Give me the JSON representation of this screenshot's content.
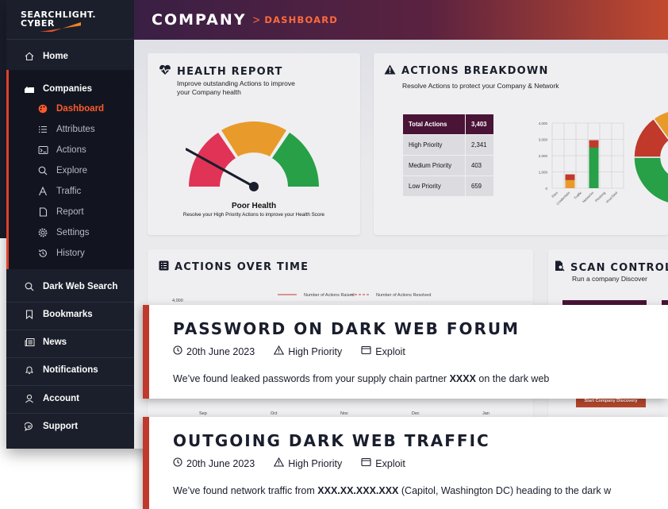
{
  "brand": {
    "line1": "SEARCHLIGHT.",
    "line2": "CYBER"
  },
  "header": {
    "title": "COMPANY",
    "separator": ">",
    "breadcrumb": "DASHBOARD"
  },
  "sidebar": {
    "home": "Home",
    "companies": "Companies",
    "sub_items": [
      {
        "label": "Dashboard",
        "icon": "palette-icon",
        "active": true
      },
      {
        "label": "Attributes",
        "icon": "list-icon"
      },
      {
        "label": "Actions",
        "icon": "actions-icon"
      },
      {
        "label": "Explore",
        "icon": "search-icon"
      },
      {
        "label": "Traffic",
        "icon": "traffic-icon"
      },
      {
        "label": "Report",
        "icon": "report-icon"
      },
      {
        "label": "Settings",
        "icon": "gear-icon"
      },
      {
        "label": "History",
        "icon": "history-icon"
      }
    ],
    "bottom_items": [
      {
        "label": "Dark Web Search",
        "icon": "search-icon"
      },
      {
        "label": "Bookmarks",
        "icon": "bookmark-icon"
      },
      {
        "label": "News",
        "icon": "news-icon"
      },
      {
        "label": "Notifications",
        "icon": "bell-icon"
      },
      {
        "label": "Account",
        "icon": "user-icon"
      },
      {
        "label": "Support",
        "icon": "chat-icon"
      }
    ]
  },
  "health": {
    "title": "HEALTH REPORT",
    "subtitle_1": "Improve outstanding Actions to improve",
    "subtitle_2": "your Company health",
    "status": "Poor Health",
    "note": "Resolve your High Priority Actions to improve your Health Score",
    "colors": {
      "red": "#e03355",
      "orange": "#e89b2a",
      "green": "#27a047"
    }
  },
  "actions": {
    "title": "ACTIONS BREAKDOWN",
    "subtitle": "Resolve Actions to protect your Company & Network",
    "table": [
      {
        "label": "Total Actions",
        "value": "3,403"
      },
      {
        "label": "High Priority",
        "value": "2,341"
      },
      {
        "label": "Medium Priority",
        "value": "403"
      },
      {
        "label": "Low Priority",
        "value": "659"
      }
    ]
  },
  "chart_data": [
    {
      "type": "bar",
      "categories": [
        "Files",
        "Credentials",
        "Traffic",
        "Networks",
        "Phishing",
        "VirusTotal"
      ],
      "series": [
        {
          "color": "#c0392b",
          "values": [
            0,
            850,
            0,
            2950,
            0,
            0
          ]
        },
        {
          "color": "#e89b2a",
          "values": [
            0,
            500,
            0,
            300,
            0,
            0
          ]
        },
        {
          "color": "#27a047",
          "values": [
            0,
            0,
            0,
            2500,
            0,
            0
          ]
        }
      ],
      "yticks": [
        "0",
        "1,000",
        "2,000",
        "3,000",
        "4,000"
      ],
      "ylim": [
        0,
        4000
      ]
    },
    {
      "type": "pie",
      "slices": [
        {
          "color": "#e89b2a",
          "value": 45
        },
        {
          "color": "#27a047",
          "value": 40
        },
        {
          "color": "#c0392b",
          "value": 15
        }
      ]
    }
  ],
  "overtime": {
    "title": "ACTIONS OVER TIME",
    "legend_raised": "Number of Actions Raised",
    "legend_resolved": "Number of Actions Resolved",
    "ymax": "4,000",
    "months": [
      "Sep",
      "Oct",
      "Nov",
      "Dec",
      "Jan"
    ]
  },
  "scan": {
    "title": "SCAN CONTROL",
    "subtitle": "Run a company Discover",
    "button": "Start Company Discovery"
  },
  "alerts": [
    {
      "title": "PASSWORD ON DARK WEB FORUM",
      "date": "20th June 2023",
      "priority": "High Priority",
      "type": "Exploit",
      "msg_a": "We’ve found leaked passwords from your supply chain partner ",
      "msg_b": "XXXX",
      "msg_c": " on the dark web"
    },
    {
      "title": "OUTGOING DARK WEB TRAFFIC",
      "date": "20th June 2023",
      "priority": "High Priority",
      "type": "Exploit",
      "msg_a": "We’ve found network traffic from ",
      "msg_b": "XXX.XX.XXX.XXX",
      "msg_c": " (Capitol, Washington DC) heading to the dark w"
    }
  ]
}
